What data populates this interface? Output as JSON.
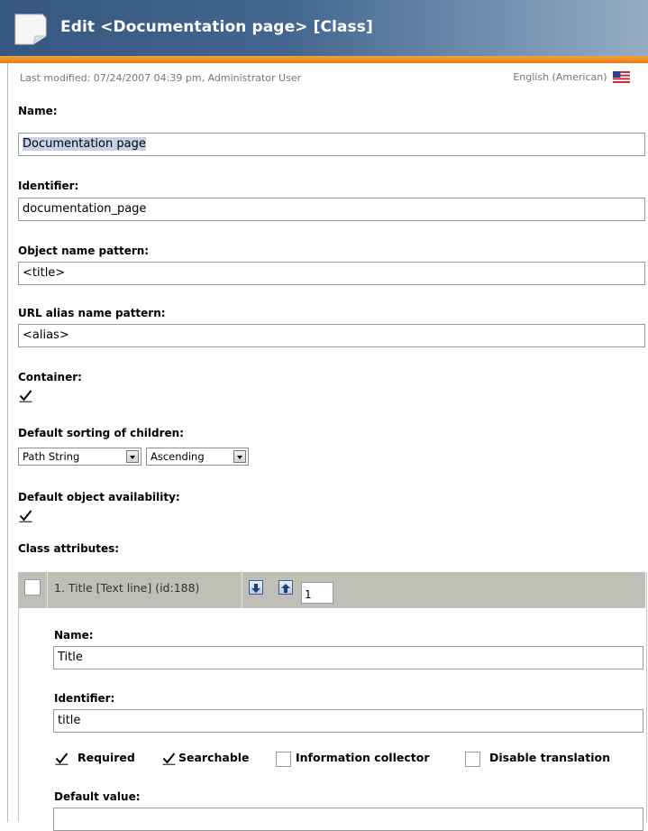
{
  "header": {
    "title": "Edit <Documentation page> [Class]",
    "icon": "document-page-icon"
  },
  "meta": {
    "last_modified": "Last modified: 07/24/2007 04:39 pm, Administrator User",
    "language": "English (American)",
    "flag_icon": "us-flag-icon"
  },
  "form": {
    "name_label": "Name:",
    "name_value": "Documentation page",
    "identifier_label": "Identifier:",
    "identifier_value": "documentation_page",
    "object_name_pattern_label": "Object name pattern:",
    "object_name_pattern_value": "<title>",
    "url_alias_label": "URL alias name pattern:",
    "url_alias_value": "<alias>",
    "container_label": "Container:",
    "container_checked": true,
    "sorting_label": "Default sorting of children:",
    "sorting_field": "Path String",
    "sorting_order": "Ascending",
    "availability_label": "Default object availability:",
    "availability_checked": true,
    "class_attributes_label": "Class attributes:"
  },
  "attribute": {
    "title": "1. Title [Text line] (id:188)",
    "placement": "1",
    "name_label": "Name:",
    "name_value": "Title",
    "identifier_label": "Identifier:",
    "identifier_value": "title",
    "required_label": "Required",
    "required_checked": true,
    "searchable_label": "Searchable",
    "searchable_checked": true,
    "info_collector_label": "Information collector",
    "info_collector_checked": false,
    "disable_translation_label": "Disable translation",
    "disable_translation_checked": false,
    "default_value_label": "Default value:",
    "default_value": ""
  },
  "colors": {
    "header_blue": "#44678f",
    "header_orange": "#e8771a",
    "attribute_bar": "#bfbfb8",
    "selection": "#c5d3e6"
  }
}
